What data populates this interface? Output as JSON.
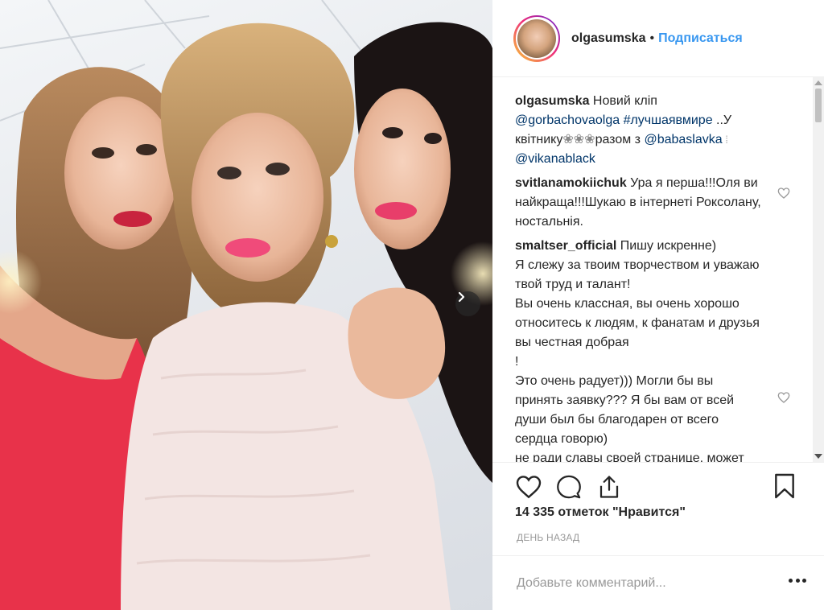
{
  "post": {
    "username": "olgasumska",
    "separator": "•",
    "follow_label": "Подписаться"
  },
  "caption": {
    "author": "olgasumska",
    "text_1": " Новий кліп ",
    "mention_1": "@gorbachovaolga",
    "hashtag": "#лучшаявмире",
    "text_2": " ..У квітнику",
    "flowers": "❀❀❀",
    "text_3": "разом з ",
    "mention_2": "@babaslavka",
    "mid_glyph": " ⁞ ",
    "mention_3": "@vikanablack"
  },
  "comments": [
    {
      "author": "svitlanamokiichuk",
      "text": " Ура я перша!!!Оля ви найкраща!!!Шукаю в інтернеті Роксолану, ностальнія."
    },
    {
      "author": "smaltser_official",
      "lines": [
        " Пишу искренне)",
        "Я слежу за твоим творчеством и уважаю твой труд и талант!",
        "Вы очень классная, вы очень хорошо относитесь к людям, к фанатам и друзья вы честная добрая",
        "!",
        "Это очень радует))) Могли бы вы принять заявку??? Я бы вам от всей души был бы благодарен от всего сердца говорю)",
        "не ради славы своей странице, может вы так подумайте))) но честно говорю уважаю все ваше"
      ]
    }
  ],
  "stats": {
    "likes": "14 335 отметок \"Нравится\"",
    "time": "ДЕНЬ НАЗАД"
  },
  "add_comment": {
    "placeholder": "Добавьте комментарий..."
  },
  "icons": {
    "like": "heart-outline-icon",
    "comment": "speech-bubble-icon",
    "share": "share-upload-icon",
    "save": "bookmark-icon",
    "next": "chevron-right-icon",
    "more": "more-dots-icon"
  }
}
